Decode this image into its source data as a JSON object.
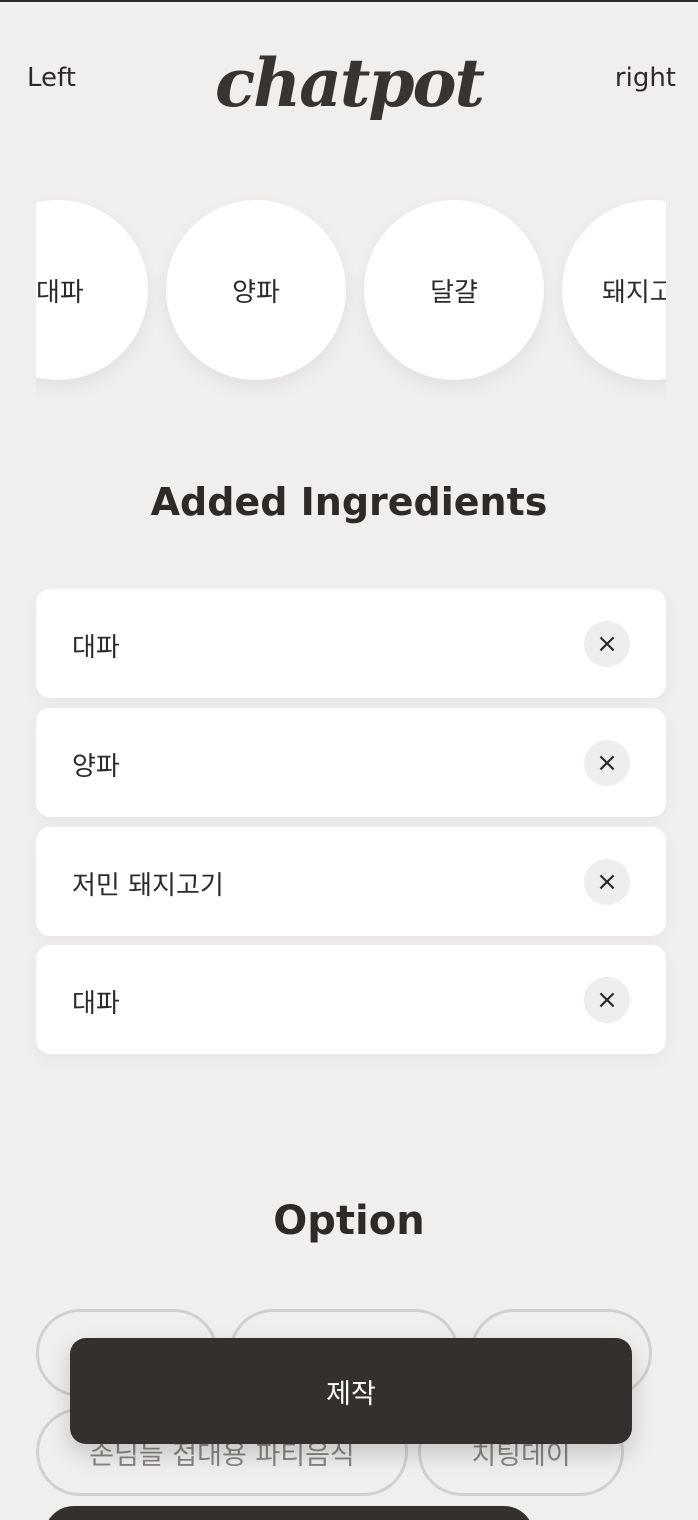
{
  "header": {
    "left_label": "Left",
    "logo_text": "chatpot",
    "right_label": "right"
  },
  "carousel": {
    "items": [
      "대파",
      "양파",
      "달걀",
      "돼지고"
    ]
  },
  "added": {
    "title": "Added Ingredients",
    "items": [
      "대파",
      "양파",
      "저민 돼지고기",
      "대파"
    ],
    "remove_icon": "×"
  },
  "option": {
    "title": "Option",
    "chips": [
      "",
      "",
      "",
      "손님들 접대용 파티음식",
      "치팅데이"
    ]
  },
  "action": {
    "make_label": "제작"
  }
}
